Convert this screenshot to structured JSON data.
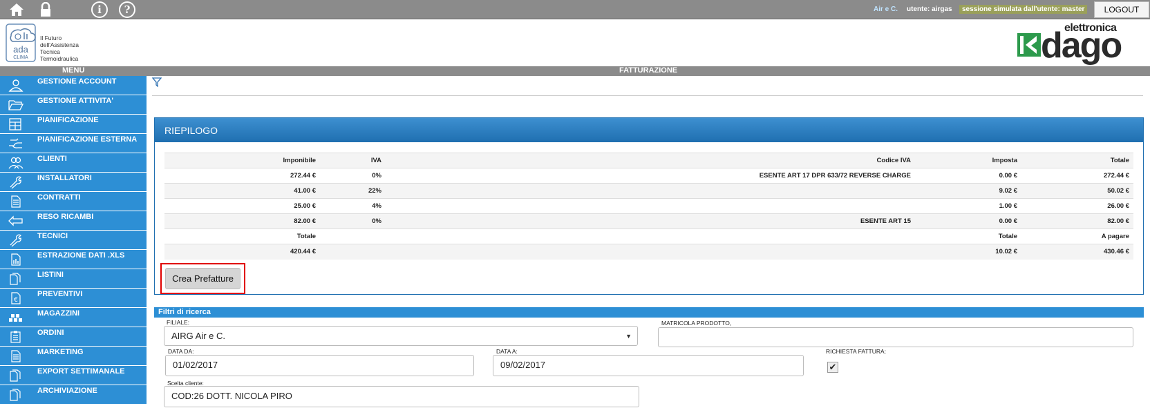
{
  "topbar": {
    "org": "Air e C.",
    "user": "utente: airgas",
    "session": "sessione simulata dall'utente: master",
    "logout_label": "LOGOUT",
    "info_glyph": "i",
    "help_glyph": "?"
  },
  "header": {
    "ada_letters": "ada",
    "ada_sub": "CLIMA",
    "tagline": [
      "Il Futuro",
      "dell'Assistenza",
      "Tecnica",
      "Termoidraulica"
    ],
    "brand_top": "elettronica",
    "brand_main": "dago"
  },
  "sectbar": {
    "menu": "MENU",
    "title": "FATTURAZIONE"
  },
  "sidebar": {
    "items": [
      {
        "label": "GESTIONE ACCOUNT",
        "icon": "user-icon"
      },
      {
        "label": "GESTIONE ATTIVITA'",
        "icon": "folder-open-icon"
      },
      {
        "label": "PIANIFICAZIONE",
        "icon": "grid-icon"
      },
      {
        "label": "PIANIFICAZIONE ESTERNA",
        "icon": "hand-icon"
      },
      {
        "label": "CLIENTI",
        "icon": "users-icon"
      },
      {
        "label": "INSTALLATORI",
        "icon": "wrench-icon"
      },
      {
        "label": "CONTRATTI",
        "icon": "document-icon"
      },
      {
        "label": "RESO RICAMBI",
        "icon": "return-icon"
      },
      {
        "label": "TECNICI",
        "icon": "wrench-icon"
      },
      {
        "label": "ESTRAZIONE DATI .XLS",
        "icon": "spreadsheet-icon"
      },
      {
        "label": "LISTINI",
        "icon": "documents-icon"
      },
      {
        "label": "PREVENTIVI",
        "icon": "euro-document-icon"
      },
      {
        "label": "MAGAZZINI",
        "icon": "warehouse-icon"
      },
      {
        "label": "ORDINI",
        "icon": "clipboard-icon"
      },
      {
        "label": "MARKETING",
        "icon": "document-icon"
      },
      {
        "label": "EXPORT SETTIMANALE",
        "icon": "documents-icon"
      },
      {
        "label": "ARCHIVIAZIONE",
        "icon": "documents-icon"
      }
    ]
  },
  "riepilogo": {
    "title": "RIEPILOGO",
    "headers": [
      "Imponibile",
      "IVA",
      "Codice IVA",
      "Imposta",
      "Totale"
    ],
    "rows": [
      [
        "272.44 €",
        "0%",
        "ESENTE ART 17 DPR 633/72 REVERSE CHARGE",
        "0.00 €",
        "272.44 €"
      ],
      [
        "41.00 €",
        "22%",
        "",
        "9.02 €",
        "50.02 €"
      ],
      [
        "25.00 €",
        "4%",
        "",
        "1.00 €",
        "26.00 €"
      ],
      [
        "82.00 €",
        "0%",
        "ESENTE ART 15",
        "0.00 €",
        "82.00 €"
      ]
    ],
    "total_headers": [
      "Totale",
      "",
      "",
      "Totale",
      "A pagare"
    ],
    "totals": [
      "420.44 €",
      "",
      "",
      "10.02 €",
      "430.46 €"
    ],
    "button_label": "Crea Prefatture"
  },
  "filtri": {
    "title": "Filtri di ricerca",
    "filiale_label": "FILIALE:",
    "filiale_value": "AIRG Air e C.",
    "matricola_label": "MATRICOLA PRODOTTO,",
    "matricola_value": "",
    "data_da_label": "DATA DA:",
    "data_da_value": "01/02/2017",
    "data_a_label": "DATA A:",
    "data_a_value": "09/02/2017",
    "richiesta_label": "RICHIESTA FATTURA:",
    "richiesta_checked": true,
    "cliente_label": "Scelta cliente:",
    "cliente_value": "COD:26 DOTT. NICOLA PIRO"
  }
}
